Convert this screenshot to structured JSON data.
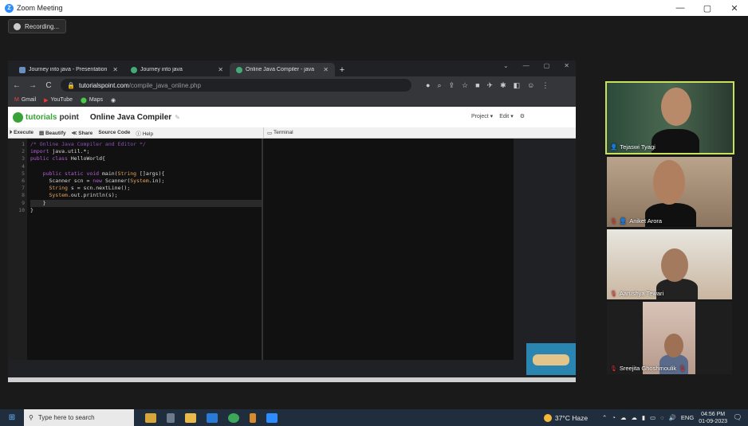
{
  "zoom": {
    "title": "Zoom Meeting",
    "recording_label": "Recording..."
  },
  "browser": {
    "tabs": [
      {
        "title": "Journey into java - Presentation"
      },
      {
        "title": "Journey into java"
      },
      {
        "title": "Online Java Compiler - java"
      }
    ],
    "new_tab": "+",
    "url_host": "tutorialspoint.com",
    "url_path": "/compile_java_online.php",
    "bookmarks": [
      "Gmail",
      "YouTube",
      "Maps"
    ]
  },
  "page": {
    "logo_text_1": "tutorials",
    "logo_text_2": "point",
    "title": "Online Java Compiler",
    "project_menu": "Project ▾",
    "edit_menu": "Edit ▾",
    "toolbar": {
      "execute": "Execute",
      "beautify": "Beautify",
      "share": "Share",
      "source_code": "Source Code",
      "help": "Help",
      "terminal": "Terminal"
    },
    "line_numbers": [
      "1",
      "2",
      "3",
      "4",
      "5",
      "6",
      "7",
      "8",
      "9",
      "10"
    ]
  },
  "participants": [
    {
      "name": "Tejaswi Tyagi"
    },
    {
      "name": "Aniket Arora"
    },
    {
      "name": "Aarushya Tewari"
    },
    {
      "name": "Sreejita Ghoshmoulik"
    }
  ],
  "taskbar": {
    "search_placeholder": "Type here to search",
    "weather": "37°C Haze",
    "lang": "ENG",
    "time": "04:56 PM",
    "date": "01-09-2023"
  }
}
